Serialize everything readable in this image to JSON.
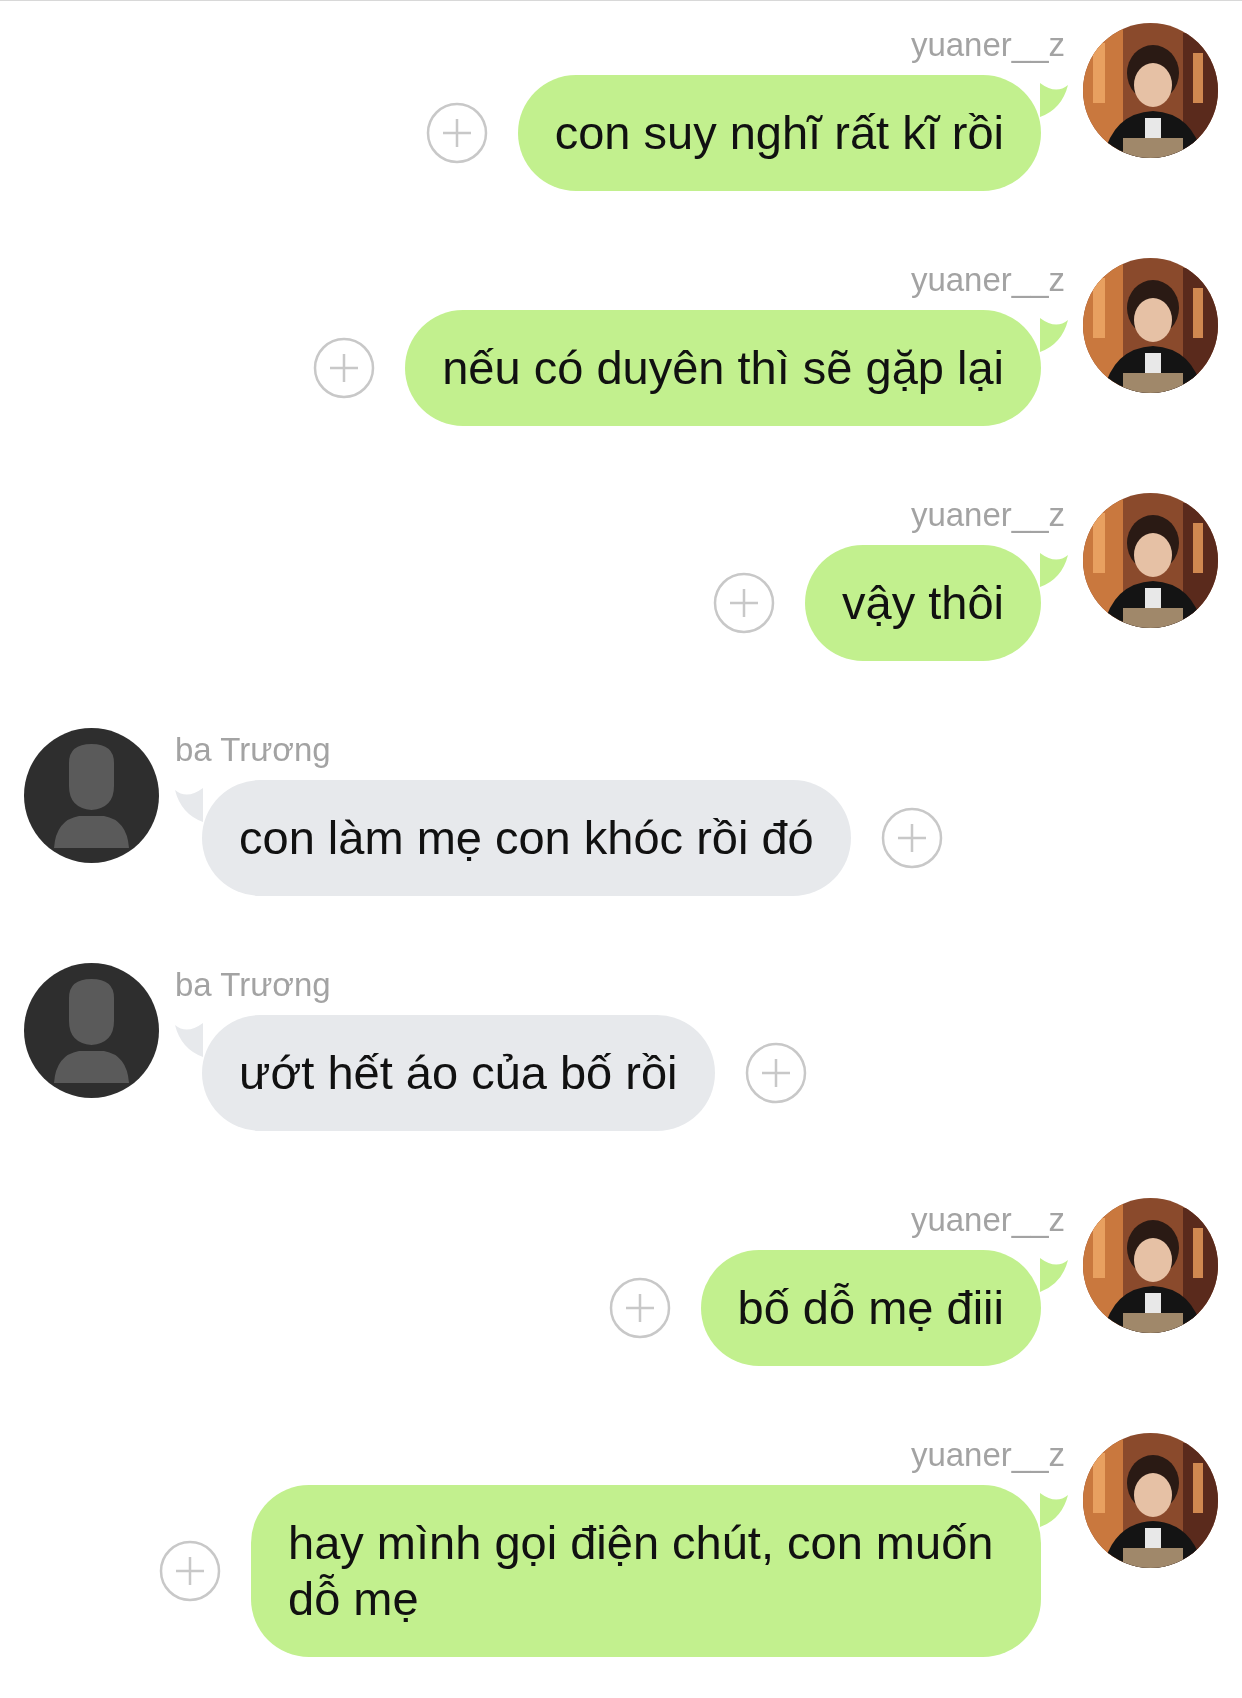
{
  "messages": [
    {
      "kind": "outgoing",
      "sender": "yuaner__z",
      "text": "con suy nghĩ rất kĩ rồi"
    },
    {
      "kind": "outgoing",
      "sender": "yuaner__z",
      "text": "nếu có duyên thì sẽ gặp lại"
    },
    {
      "kind": "outgoing",
      "sender": "yuaner__z",
      "text": "vậy thôi"
    },
    {
      "kind": "incoming",
      "sender": "ba Trương",
      "text": "con làm mẹ con khóc rồi đó"
    },
    {
      "kind": "incoming",
      "sender": "ba Trương",
      "text": "ướt hết áo của bố rồi"
    },
    {
      "kind": "outgoing",
      "sender": "yuaner__z",
      "text": "bố dỗ mẹ điii"
    },
    {
      "kind": "outgoing",
      "sender": "yuaner__z",
      "text": "hay mình gọi điện chút, con muốn dỗ mẹ"
    }
  ]
}
